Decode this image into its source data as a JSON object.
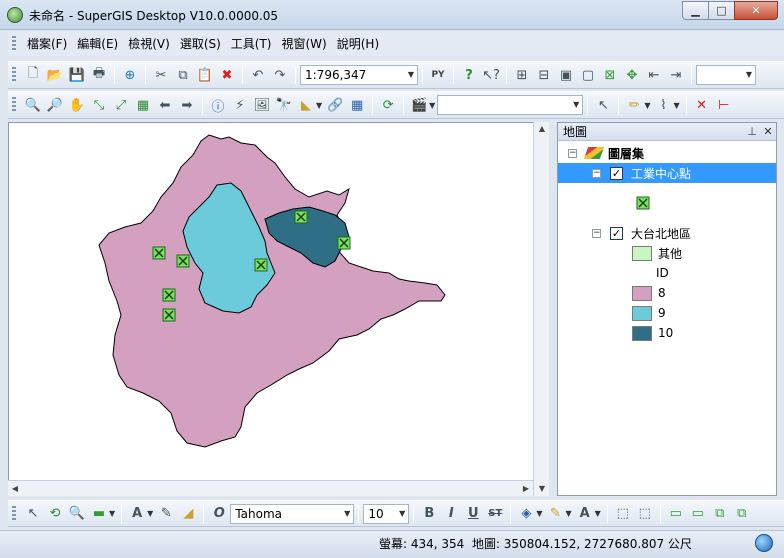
{
  "window": {
    "title": "未命名 - SuperGIS Desktop V10.0.0000.05"
  },
  "menu": [
    "檔案(F)",
    "編輯(E)",
    "檢視(V)",
    "選取(S)",
    "工具(T)",
    "視窗(W)",
    "說明(H)"
  ],
  "toolbar": {
    "scale": "1:796,347",
    "scale_combo_right": "",
    "layer_combo": ""
  },
  "toc": {
    "title": "地圖",
    "root": "圖層集",
    "layers": [
      {
        "name": "工業中心點",
        "checked": true,
        "selected": true
      },
      {
        "name": "大台北地區",
        "checked": true,
        "selected": false,
        "legend_header": "ID",
        "other_label": "其他",
        "classes": [
          {
            "label": "8",
            "color": "#d4a0c0"
          },
          {
            "label": "9",
            "color": "#6ccbdb"
          },
          {
            "label": "10",
            "color": "#2e6f85"
          }
        ]
      }
    ],
    "other_color": "#c8f5c0"
  },
  "drawbar": {
    "font": "Tahoma",
    "size": "10"
  },
  "status": {
    "screen": "螢幕: 434, 354",
    "map": "地圖: 350804.152, 2727680.807 公尺"
  },
  "colors": {
    "region8": "#d4a0c0",
    "region9": "#6ccbdb",
    "region10": "#2e6f85",
    "point": "#7ce05a"
  }
}
